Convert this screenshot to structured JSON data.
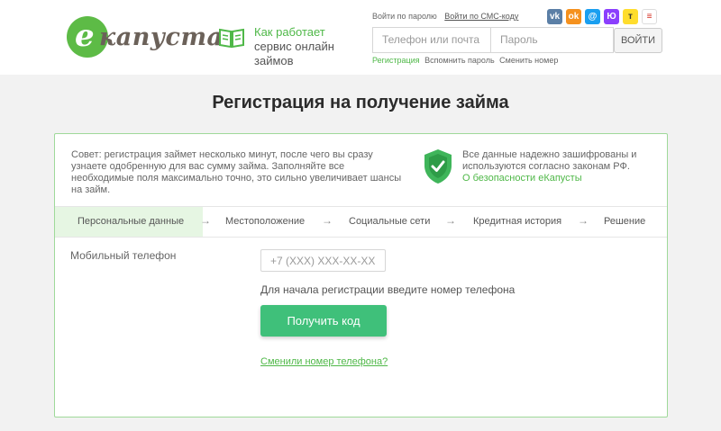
{
  "header": {
    "logo": {
      "letter": "е",
      "text": "капуста"
    },
    "how_it_works": {
      "line1": "Как работает",
      "line2": "сервис онлайн займов"
    },
    "login_links": {
      "by_password": "Войти по паролю",
      "by_sms": "Войти по СМС-коду"
    },
    "social": [
      {
        "icon": "vk-icon",
        "label": "vk",
        "color": "#5b7fa6"
      },
      {
        "icon": "odnoklassniki-icon",
        "label": "ok",
        "color": "#f5911e"
      },
      {
        "icon": "mail-at-icon",
        "label": "@",
        "color": "#1a9ff0"
      },
      {
        "icon": "yumoney-icon",
        "label": "Ю",
        "color": "#8b3ffd"
      },
      {
        "icon": "tinkoff-icon",
        "label": "т",
        "color": "#ffdd2d"
      },
      {
        "icon": "gosuslugi-icon",
        "label": "≡",
        "color": "#ffffff"
      }
    ],
    "phone_placeholder": "Телефон или почта",
    "password_placeholder": "Пароль",
    "login_button": "ВОЙТИ",
    "sub_links": {
      "register": "Регистрация",
      "remind": "Вспомнить пароль",
      "change_number": "Сменить номер"
    }
  },
  "page_title": "Регистрация на получение займа",
  "card": {
    "tip": "Совет: регистрация займет несколько минут, после чего вы сразу узнаете одобренную для вас сумму займа. Заполняйте все необходимые поля максимально точно, это сильно увеличивает шансы на займ.",
    "secure_text": "Все данные надежно зашифрованы и используются согласно законам РФ.",
    "secure_link": "О безопасности еКапусты",
    "steps": [
      "Персональные данные",
      "Местоположение",
      "Социальные сети",
      "Кредитная история",
      "Решение"
    ],
    "arrow": "→",
    "active_step": 0,
    "field_label": "Мобильный телефон",
    "phone_placeholder": "+7 (XXX) XXX-XX-XX",
    "hint": "Для начала регистрации введите номер телефона",
    "get_code_button": "Получить код",
    "changed_number_link": "Сменили номер телефона?"
  },
  "colors": {
    "brand_green": "#4fb848",
    "button_green": "#3fc07a",
    "logo_green": "#5dbb46"
  }
}
